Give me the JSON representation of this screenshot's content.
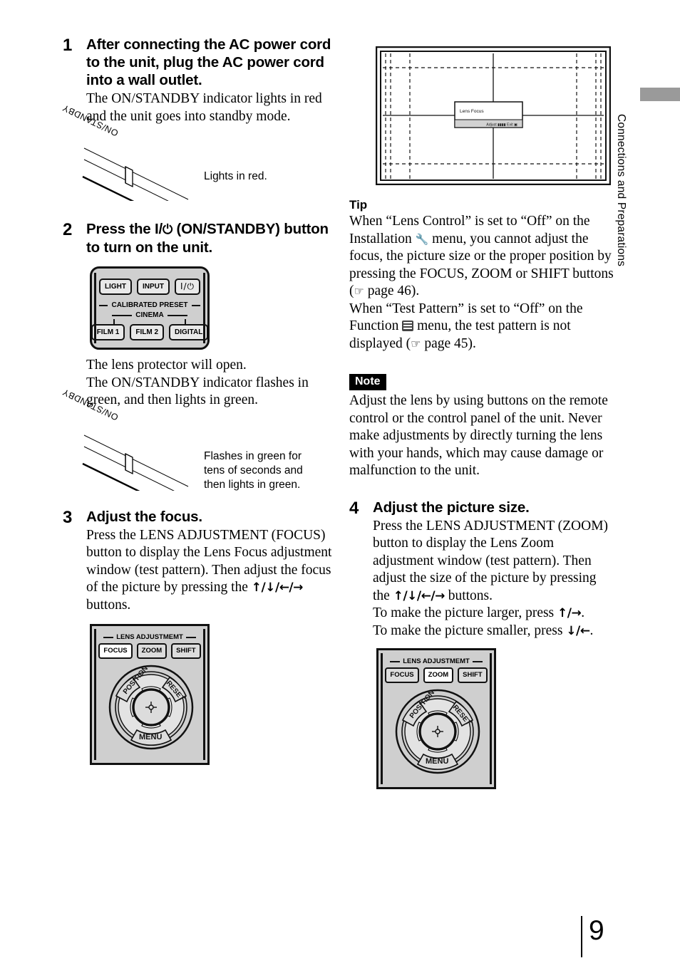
{
  "page": {
    "number": "9",
    "side_tab": "Connections and Preparations"
  },
  "steps": [
    {
      "num": "1",
      "heading": "After connecting the AC power cord to the unit, plug the AC power cord into a wall outlet.",
      "body": "The ON/STANDBY indicator lights in red and the unit goes into standby mode.",
      "figure_caption": "Lights in red.",
      "indicator_label": "ON/STANDBY"
    },
    {
      "num": "2",
      "heading_pre": "Press the I/",
      "heading_post": " (ON/STANDBY) button to turn on the unit.",
      "power_glyph": "⏻",
      "body": "The lens protector will open.\nThe ON/STANDBY indicator flashes in green, and then lights in green.",
      "figure_caption": "Flashes in green for tens of seconds and then lights in green.",
      "indicator_label": "ON/STANDBY"
    },
    {
      "num": "3",
      "heading": "Adjust the focus.",
      "body_pre": "Press the LENS ADJUSTMENT (FOCUS) button to display the Lens Focus adjustment window (test pattern). Then adjust the focus of the picture by pressing the ",
      "arrows": "↑/↓/←/→",
      "body_post": " buttons."
    },
    {
      "num": "4",
      "heading": "Adjust the picture size.",
      "body_pre": "Press the LENS ADJUSTMENT (ZOOM) button to display the Lens Zoom adjustment window (test pattern). Then adjust the size of the picture by pressing the ",
      "arrows": "↑/↓/←/→",
      "body_mid": " buttons.",
      "larger_pre": "To make the picture larger, press ",
      "larger_arrows": "↑/→",
      "larger_post": ".",
      "smaller_pre": "To make the picture smaller, press ",
      "smaller_arrows": "↓/←",
      "smaller_post": "."
    }
  ],
  "remote": {
    "row1": [
      "LIGHT",
      "INPUT"
    ],
    "power_label": "I/⏻",
    "calibrated_preset": "CALIBRATED PRESET",
    "cinema": "CINEMA",
    "presets": [
      "FILM 1",
      "FILM 2",
      "DIGITAL"
    ]
  },
  "control_panel": {
    "group_label": "LENS ADJUSTMEMT",
    "buttons": [
      "FOCUS",
      "ZOOM",
      "SHIFT"
    ],
    "dial": {
      "position": "POSITION",
      "reset": "RESET",
      "menu": "MENU"
    },
    "focus_active": "FOCUS",
    "zoom_active": "ZOOM"
  },
  "test_pattern": {
    "osd_title": "Lens Focus",
    "osd_footer": "Adjust Exit"
  },
  "tip": {
    "title": "Tip",
    "line1_a": "When “Lens Control” is set to “Off” on the Installation ",
    "line1_icon": "wrench-icon",
    "line1_b": " menu, you cannot adjust the focus, the picture size or the proper position by pressing the FOCUS, ZOOM or SHIFT buttons (",
    "line1_page": " page 46).",
    "line2_a": "When “Test Pattern” is set to “Off” on the Function ",
    "line2_icon": "function-menu-icon",
    "line2_b": " menu, the test pattern is not displayed (",
    "line2_page": " page 45)."
  },
  "note": {
    "title": "Note",
    "body": "Adjust the lens by using buttons on the remote control or the control panel of the unit. Never make adjustments by directly turning the lens with your hands, which may cause damage or malfunction to the unit."
  },
  "colors": {
    "panel_grey": "#cfcfcf",
    "tab_grey": "#9a9a9a",
    "osd_bar": "#d2d2d2"
  }
}
